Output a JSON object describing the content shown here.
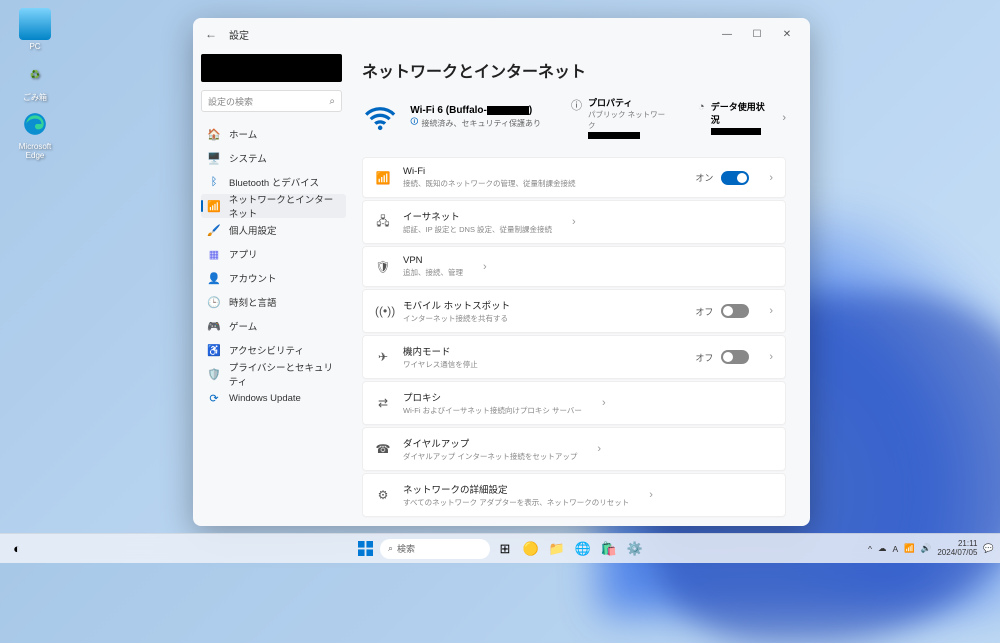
{
  "desktop": {
    "icons": [
      {
        "label": "PC"
      },
      {
        "label": "ごみ箱"
      },
      {
        "label": "Microsoft Edge"
      }
    ]
  },
  "window": {
    "title": "設定",
    "search_placeholder": "設定の検索",
    "page_title": "ネットワークとインターネット",
    "nav": [
      {
        "icon": "home",
        "label": "ホーム",
        "color": "#3b82f6"
      },
      {
        "icon": "system",
        "label": "システム",
        "color": "#1e40af"
      },
      {
        "icon": "bluetooth",
        "label": "Bluetooth とデバイス",
        "color": "#0067c0"
      },
      {
        "icon": "network",
        "label": "ネットワークとインターネット",
        "color": "#0067c0",
        "selected": true
      },
      {
        "icon": "personalize",
        "label": "個人用設定",
        "color": "#d97706"
      },
      {
        "icon": "apps",
        "label": "アプリ",
        "color": "#6366f1"
      },
      {
        "icon": "account",
        "label": "アカウント",
        "color": "#10b981"
      },
      {
        "icon": "time",
        "label": "時刻と言語",
        "color": "#6b7280"
      },
      {
        "icon": "gaming",
        "label": "ゲーム",
        "color": "#6b7280"
      },
      {
        "icon": "access",
        "label": "アクセシビリティ",
        "color": "#0891b2"
      },
      {
        "icon": "privacy",
        "label": "プライバシーとセキュリティ",
        "color": "#6b7280"
      },
      {
        "icon": "update",
        "label": "Windows Update",
        "color": "#0067c0"
      }
    ],
    "hero": {
      "wifi_name_prefix": "Wi-Fi 6 (Buffalo-",
      "wifi_name_suffix": ")",
      "status": "接続済み、セキュリティ保護あり",
      "properties_label": "プロパティ",
      "properties_sub": "パブリック ネットワーク",
      "data_usage_label": "データ使用状況"
    },
    "cards": [
      {
        "icon": "wifi",
        "title": "Wi-Fi",
        "sub": "接続、既知のネットワークの管理、従量制課金接続",
        "toggle": "on",
        "toggle_label": "オン"
      },
      {
        "icon": "ethernet",
        "title": "イーサネット",
        "sub": "認証、IP 設定と DNS 設定、従量制課金接続"
      },
      {
        "icon": "vpn",
        "title": "VPN",
        "sub": "追加、接続、管理"
      },
      {
        "icon": "hotspot",
        "title": "モバイル ホットスポット",
        "sub": "インターネット接続を共有する",
        "toggle": "off",
        "toggle_label": "オフ"
      },
      {
        "icon": "airplane",
        "title": "機内モード",
        "sub": "ワイヤレス通信を停止",
        "toggle": "off",
        "toggle_label": "オフ"
      },
      {
        "icon": "proxy",
        "title": "プロキシ",
        "sub": "Wi-Fi およびイーサネット接続向けプロキシ サーバー"
      },
      {
        "icon": "dialup",
        "title": "ダイヤルアップ",
        "sub": "ダイヤルアップ インターネット接続をセットアップ"
      },
      {
        "icon": "advanced",
        "title": "ネットワークの詳細設定",
        "sub": "すべてのネットワーク アダプターを表示、ネットワークのリセット"
      }
    ]
  },
  "taskbar": {
    "search_placeholder": "検索",
    "time": "21:11",
    "date": "2024/07/05",
    "ime": "A"
  }
}
